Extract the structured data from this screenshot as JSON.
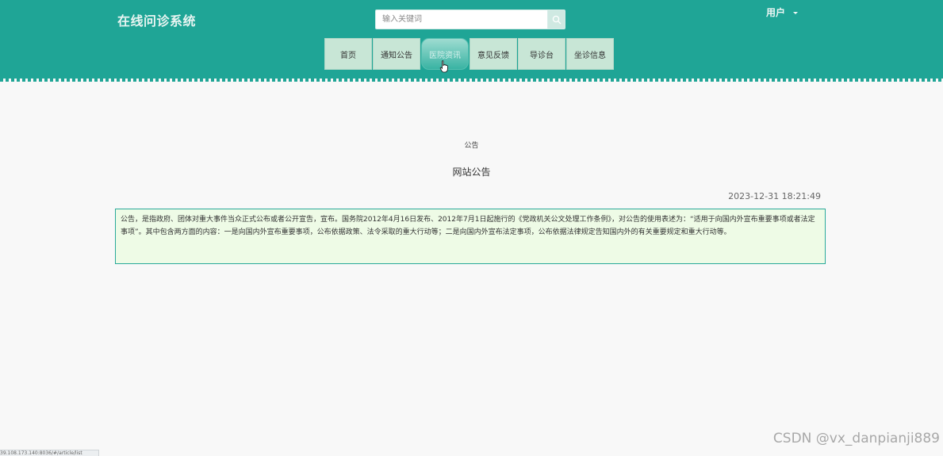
{
  "header": {
    "site_title": "在线问诊系统",
    "search_placeholder": "输入关键词",
    "user_label": "用户"
  },
  "nav": {
    "items": [
      {
        "label": "首页"
      },
      {
        "label": "通知公告"
      },
      {
        "label": "医院资讯"
      },
      {
        "label": "意见反馈"
      },
      {
        "label": "导诊台"
      },
      {
        "label": "坐诊信息"
      }
    ]
  },
  "article": {
    "category": "公告",
    "title": "网站公告",
    "time": "2023-12-31 18:21:49",
    "body": "公告，是指政府、团体对重大事件当众正式公布或者公开宣告，宣布。国务院2012年4月16日发布、2012年7月1日起施行的《党政机关公文处理工作条例》，对公告的使用表述为：“适用于向国内外宣布重要事项或者法定事项”。其中包含两方面的内容：一是向国内外宣布重要事项，公布依据政策、法令采取的重大行动等；二是向国内外宣布法定事项，公布依据法律规定告知国内外的有关重要规定和重大行动等。"
  },
  "status_bar": {
    "url": "39.108.173.140:8036/#/article/list"
  },
  "watermark": "CSDN @vx_danpianji889"
}
